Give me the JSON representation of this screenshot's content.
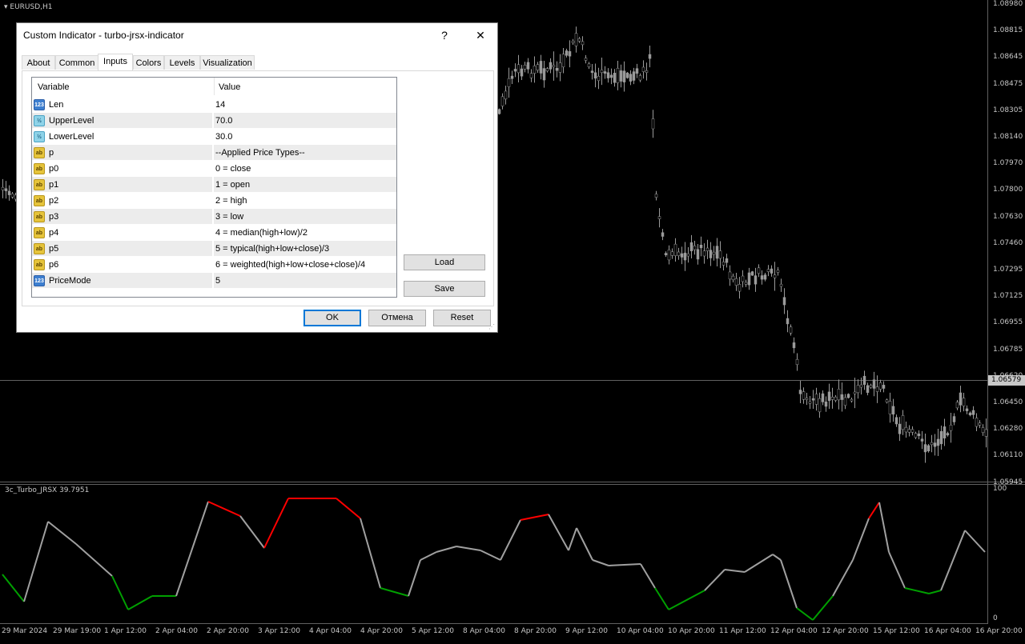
{
  "chart": {
    "symbol_label": "EURUSD,H1",
    "indicator_label": "3c_Turbo_JRSX 39.7951",
    "current_price": "1.06579",
    "price_axis": [
      "1.08980",
      "1.08815",
      "1.08645",
      "1.08475",
      "1.08305",
      "1.08140",
      "1.07970",
      "1.07800",
      "1.07630",
      "1.07460",
      "1.07295",
      "1.07125",
      "1.06955",
      "1.06785",
      "1.06620",
      "1.06450",
      "1.06280",
      "1.06110",
      "1.05945"
    ],
    "indicator_axis": [
      "100",
      "0"
    ],
    "time_axis": [
      "29 Mar 2024",
      "29 Mar 19:00",
      "1 Apr 12:00",
      "2 Apr 04:00",
      "2 Apr 20:00",
      "3 Apr 12:00",
      "4 Apr 04:00",
      "4 Apr 20:00",
      "5 Apr 12:00",
      "8 Apr 04:00",
      "8 Apr 20:00",
      "9 Apr 12:00",
      "10 Apr 04:00",
      "10 Apr 20:00",
      "11 Apr 12:00",
      "12 Apr 04:00",
      "12 Apr 20:00",
      "15 Apr 12:00",
      "16 Apr 04:00",
      "16 Apr 20:00"
    ],
    "colors": {
      "candle": "#9a9a9a",
      "line_neutral": "#a0a0a0",
      "line_high": "#ff0000",
      "line_low": "#00a000",
      "grid": "#606060"
    }
  },
  "dialog": {
    "title": "Custom Indicator - turbo-jrsx-indicator",
    "help_glyph": "?",
    "close_glyph": "✕",
    "tabs": [
      "About",
      "Common",
      "Inputs",
      "Colors",
      "Levels",
      "Visualization"
    ],
    "active_tab": "Inputs",
    "grid": {
      "col_variable": "Variable",
      "col_value": "Value",
      "rows": [
        {
          "icon": "int",
          "icon_text": "123",
          "name": "Len",
          "value": "14"
        },
        {
          "icon": "dbl",
          "icon_text": "½",
          "name": "UpperLevel",
          "value": "70.0"
        },
        {
          "icon": "dbl",
          "icon_text": "½",
          "name": "LowerLevel",
          "value": "30.0"
        },
        {
          "icon": "str",
          "icon_text": "ab",
          "name": "p",
          "value": "--Applied Price Types--"
        },
        {
          "icon": "str",
          "icon_text": "ab",
          "name": "p0",
          "value": "0 = close"
        },
        {
          "icon": "str",
          "icon_text": "ab",
          "name": "p1",
          "value": "1 = open"
        },
        {
          "icon": "str",
          "icon_text": "ab",
          "name": "p2",
          "value": "2 = high"
        },
        {
          "icon": "str",
          "icon_text": "ab",
          "name": "p3",
          "value": "3 = low"
        },
        {
          "icon": "str",
          "icon_text": "ab",
          "name": "p4",
          "value": "4 = median(high+low)/2"
        },
        {
          "icon": "str",
          "icon_text": "ab",
          "name": "p5",
          "value": "5 = typical(high+low+close)/3"
        },
        {
          "icon": "str",
          "icon_text": "ab",
          "name": "p6",
          "value": "6 = weighted(high+low+close+close)/4"
        },
        {
          "icon": "int",
          "icon_text": "123",
          "name": "PriceMode",
          "value": "5"
        }
      ]
    },
    "load_label": "Load",
    "save_label": "Save",
    "ok_label": "OK",
    "cancel_label": "Отмена",
    "reset_label": "Reset"
  }
}
